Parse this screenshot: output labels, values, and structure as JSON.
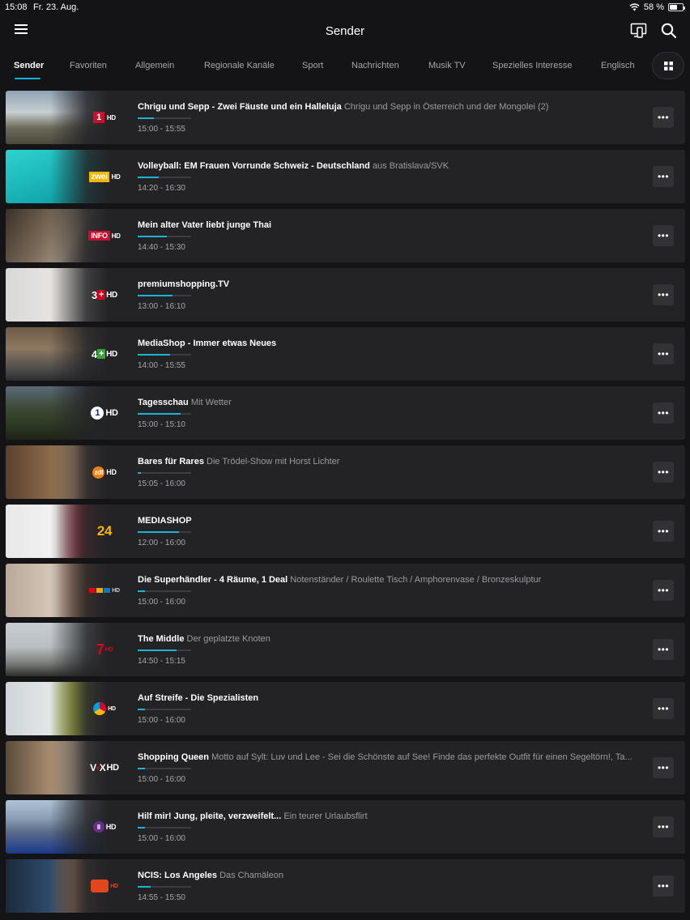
{
  "status": {
    "time": "15:08",
    "date": "Fr. 23. Aug.",
    "battery": "58 %",
    "battery_level": 0.58
  },
  "header": {
    "title": "Sender",
    "menu_icon": "hamburger-icon",
    "cast_icon": "cast-icon",
    "search_icon": "search-icon"
  },
  "tabs": [
    {
      "label": "Sender",
      "active": true
    },
    {
      "label": "Favoriten"
    },
    {
      "label": "Allgemein"
    },
    {
      "label": "Regionale Kanäle"
    },
    {
      "label": "Sport"
    },
    {
      "label": "Nachrichten"
    },
    {
      "label": "Musik TV"
    },
    {
      "label": "Spezielles Interesse"
    },
    {
      "label": "Englisch"
    }
  ],
  "colors": {
    "accent": "#1db3d6",
    "background": "#141416",
    "row": "#232326"
  },
  "channels": [
    {
      "title": "Chrigu und Sepp - Zwei Fäuste und ein Halleluja",
      "subtitle": "Chrigu und Sepp in Österreich und der Mongolei (2)",
      "time": "15:00 - 15:55",
      "progress": 0.3,
      "logo": "srf1-hd-logo"
    },
    {
      "title": "Volleyball: EM Frauen Vorrunde Schweiz - Deutschland",
      "subtitle": "aus Bratislava/SVK",
      "time": "14:20 - 16:30",
      "progress": 0.4,
      "logo": "srf-zwei-hd-logo"
    },
    {
      "title": "Mein alter Vater liebt junge Thai",
      "subtitle": "",
      "time": "14:40 - 15:30",
      "progress": 0.55,
      "logo": "srf-info-hd-logo"
    },
    {
      "title": "premiumshopping.TV",
      "subtitle": "",
      "time": "13:00 - 16:10",
      "progress": 0.65,
      "logo": "3plus-hd-logo"
    },
    {
      "title": "MediaShop - Immer etwas Neues",
      "subtitle": "",
      "time": "14:00 - 15:55",
      "progress": 0.6,
      "logo": "4plus-hd-logo"
    },
    {
      "title": "Tagesschau",
      "subtitle": "Mit Wetter",
      "time": "15:00 - 15:10",
      "progress": 0.8,
      "logo": "das-erste-hd-logo"
    },
    {
      "title": "Bares für Rares",
      "subtitle": "Die Trödel-Show mit Horst Lichter",
      "time": "15:05 - 16:00",
      "progress": 0.06,
      "logo": "zdf-hd-logo"
    },
    {
      "title": "MEDIASHOP",
      "subtitle": "",
      "time": "12:00 - 16:00",
      "progress": 0.78,
      "logo": "tv24-logo"
    },
    {
      "title": "Die Superhändler - 4 Räume, 1 Deal",
      "subtitle": "Notenständer / Roulette Tisch / Amphorenvase / Bronzeskulptur",
      "time": "15:00 - 16:00",
      "progress": 0.14,
      "logo": "rtl-hd-logo"
    },
    {
      "title": "The Middle",
      "subtitle": "Der geplatzte Knoten",
      "time": "14:50 - 15:15",
      "progress": 0.72,
      "logo": "prosieben-hd-logo"
    },
    {
      "title": "Auf Streife - Die Spezialisten",
      "subtitle": "",
      "time": "15:00 - 16:00",
      "progress": 0.14,
      "logo": "sat1-hd-logo"
    },
    {
      "title": "Shopping Queen",
      "subtitle": "Motto auf Sylt: Luv und Lee - Sei die Schönste auf See! Finde das perfekte Outfit für einen Segeltörn!, Ta...",
      "time": "15:00 - 16:00",
      "progress": 0.14,
      "logo": "vox-hd-logo"
    },
    {
      "title": "Hilf mir! Jung, pleite, verzweifelt...",
      "subtitle": "Ein teurer Urlaubsflirt",
      "time": "15:00 - 16:00",
      "progress": 0.14,
      "logo": "rtl2-hd-logo"
    },
    {
      "title": "NCIS: Los Angeles",
      "subtitle": "Das Chamäleon",
      "time": "14:55 - 15:50",
      "progress": 0.24,
      "logo": "kabel-eins-hd-logo"
    }
  ]
}
